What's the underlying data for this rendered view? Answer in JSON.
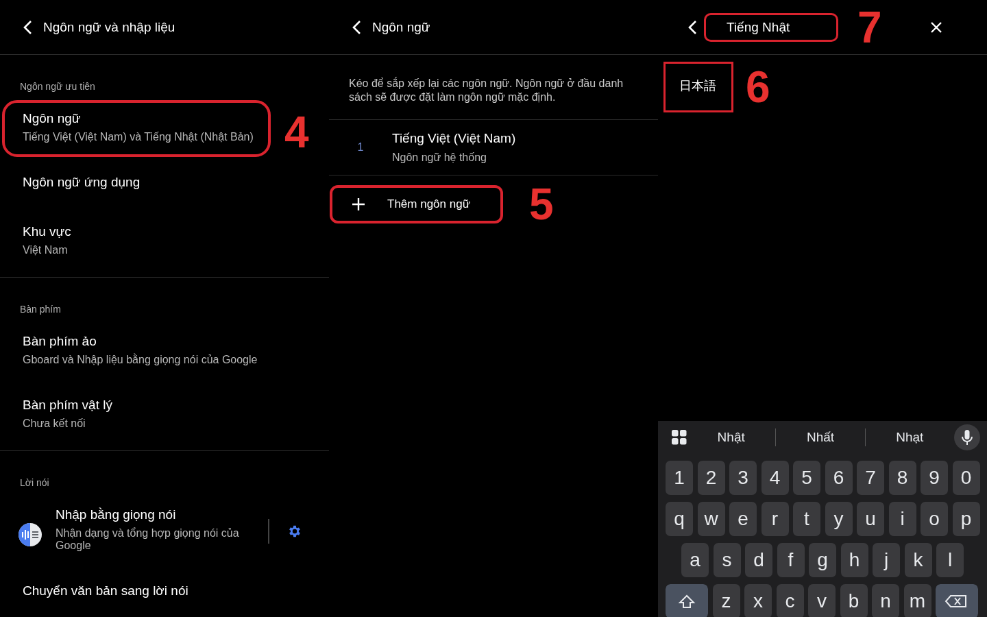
{
  "left_panel": {
    "title": "Ngôn ngữ và nhập liệu",
    "sections": [
      {
        "header": "Ngôn ngữ ưu tiên",
        "items": [
          {
            "kind": "plain",
            "title": "Ngôn ngữ",
            "subtitle": "Tiếng Việt (Việt Nam) và Tiếng Nhật (Nhật Bản)",
            "highlighted": true,
            "callout": "4"
          },
          {
            "kind": "plain",
            "title": "Ngôn ngữ ứng dụng",
            "highlighted": false
          },
          {
            "kind": "plain",
            "title": "Khu vực",
            "subtitle": "Việt Nam",
            "highlighted": false
          }
        ]
      },
      {
        "header": "Bàn phím",
        "items": [
          {
            "kind": "plain",
            "title": "Bàn phím ảo",
            "subtitle": "Gboard và Nhập liệu bằng giọng nói của Google",
            "highlighted": false
          },
          {
            "kind": "plain",
            "title": "Bàn phím vật lý",
            "subtitle": "Chưa kết nối",
            "highlighted": false
          }
        ]
      },
      {
        "header": "Lời nói",
        "items": [
          {
            "kind": "app_settings",
            "title": "Nhập bằng giọng nói",
            "subtitle": "Nhận dạng và tổng hợp giọng nói của Google",
            "highlighted": false
          },
          {
            "kind": "plain",
            "title": "Chuyển văn bản sang lời nói",
            "highlighted": false
          }
        ]
      }
    ]
  },
  "middle_panel": {
    "title": "Ngôn ngữ",
    "description": "Kéo để sắp xếp lại các ngôn ngữ. Ngôn ngữ ở đầu danh sách sẽ được đặt làm ngôn ngữ mặc định.",
    "languages": [
      {
        "index": "1",
        "name": "Tiếng Việt (Việt Nam)",
        "subtitle": "Ngôn ngữ hệ thống"
      }
    ],
    "add_button": {
      "label": "Thêm ngôn ngữ",
      "highlighted": true,
      "callout": "5"
    }
  },
  "right_panel": {
    "search": {
      "value": "Tiếng Nhật",
      "highlighted": true,
      "callout": "7"
    },
    "results": [
      {
        "label": "日本語",
        "highlighted": true,
        "callout": "6"
      }
    ],
    "keyboard": {
      "suggestions": [
        "Nhật",
        "Nhất",
        "Nhạt"
      ],
      "rows": [
        [
          "1",
          "2",
          "3",
          "4",
          "5",
          "6",
          "7",
          "8",
          "9",
          "0"
        ],
        [
          "q",
          "w",
          "e",
          "r",
          "t",
          "y",
          "u",
          "i",
          "o",
          "p"
        ],
        [
          "a",
          "s",
          "d",
          "f",
          "g",
          "h",
          "j",
          "k",
          "l"
        ],
        [
          "z",
          "x",
          "c",
          "v",
          "b",
          "n",
          "m"
        ]
      ]
    }
  }
}
